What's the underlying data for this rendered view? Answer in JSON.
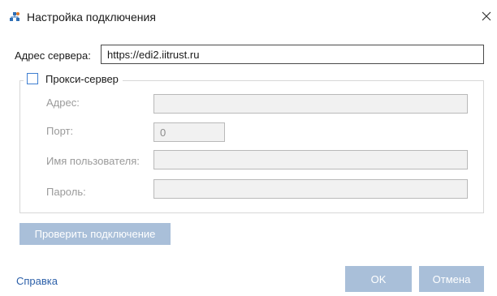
{
  "window": {
    "title": "Настройка подключения",
    "icon": "network-settings-icon",
    "close_icon": "close-icon"
  },
  "server": {
    "label": "Адрес сервера:",
    "value": "https://edi2.iitrust.ru"
  },
  "proxy": {
    "label": "Прокси-сервер",
    "checked": false,
    "fields": {
      "address": {
        "label": "Адрес:",
        "value": ""
      },
      "port": {
        "label": "Порт:",
        "value": "0"
      },
      "username": {
        "label": "Имя пользователя:",
        "value": ""
      },
      "password": {
        "label": "Пароль:",
        "value": ""
      }
    }
  },
  "buttons": {
    "check_connection": "Проверить подключение",
    "ok": "OK",
    "cancel": "Отмена"
  },
  "footer": {
    "help_link": "Справка"
  },
  "colors": {
    "accent": "#3f7fd1",
    "disabled_button": "#a9bfd9",
    "link": "#2b5fa8"
  }
}
